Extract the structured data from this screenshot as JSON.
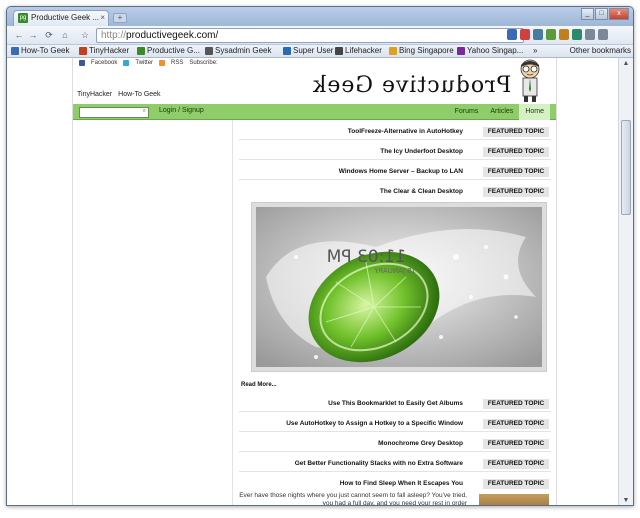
{
  "window": {
    "tab_title": "Productive Geek ...",
    "tab_close": "×",
    "new_tab": "+",
    "buttons": [
      "_",
      "□",
      "x"
    ],
    "favicon_text": "pg"
  },
  "toolbar": {
    "back": "←",
    "forward": "→",
    "reload": "⟳",
    "home": "⌂",
    "star": "☆",
    "url_scheme": "http://",
    "url_host": "productivegeek.com/"
  },
  "bookmarks": {
    "items": [
      {
        "label": "How-To Geek",
        "color": "#3b6bb4"
      },
      {
        "label": "TinyHacker",
        "color": "#c04020"
      },
      {
        "label": "Productive G...",
        "color": "#3a8a2a"
      },
      {
        "label": "Sysadmin Geek",
        "color": "#555555"
      },
      {
        "label": "Super User",
        "color": "#2a6ab0"
      },
      {
        "label": "Lifehacker",
        "color": "#444444"
      },
      {
        "label": "Bing Singapore",
        "color": "#e0a020"
      },
      {
        "label": "Yahoo Singap...",
        "color": "#7a2a9a"
      }
    ],
    "overflow": "»",
    "other": "Other bookmarks"
  },
  "site": {
    "logo": "Productive Geek",
    "topline": {
      "subscribe": "Subscribe:",
      "rss": "RSS",
      "twitter": "Twitter",
      "facebook": "Facebook"
    },
    "network": {
      "htg": "How-To Geek",
      "tiny": "TinyHacker"
    },
    "nav": {
      "home": "Home",
      "articles": "Articles",
      "forums": "Forums",
      "login": "Login / Signup",
      "search_icon": "⌕"
    },
    "featured_label": "FEATURED TOPIC",
    "featured_top": [
      "ToolFreeze-Alternative in AutoHotkey",
      "The Icy Underfoot Desktop",
      "Windows Home Server – Backup to LAN",
      "The Clear & Clean Desktop"
    ],
    "image_overlay": {
      "time": "11:03 PM",
      "date": "15 JANUARY"
    },
    "read_more": "Read More...",
    "featured_bottom": [
      "Use This Bookmarklet to Easily Get Albums",
      "Use AutoHotkey to Assign a Hotkey to a Specific Window",
      "Monochrome Grey Desktop",
      "Get Better Functionality Stacks with no Extra Software",
      "How to Find Sleep When It Escapes You"
    ],
    "last_desc": "Ever have those nights where you just cannot seem to fall asleep? You've tried, you had a full day, and you need your rest in order"
  }
}
